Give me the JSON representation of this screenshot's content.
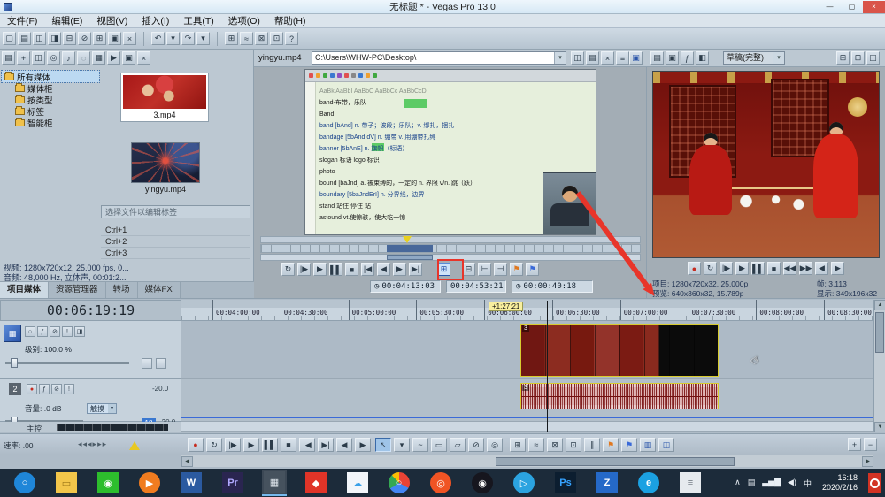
{
  "icons": {
    "caret": "▾",
    "clock": "◷",
    "up": "▲",
    "down": "▼",
    "left": "◀",
    "right": "▶",
    "hand": "☞"
  },
  "window": {
    "title": "无标题 * - Vegas Pro 13.0",
    "controls": [
      {
        "n": "minimize-button",
        "g": "—"
      },
      {
        "n": "maximize-button",
        "g": "▢"
      },
      {
        "n": "close-button",
        "g": "×"
      }
    ]
  },
  "menu": {
    "items": [
      "文件(F)",
      "编辑(E)",
      "视图(V)",
      "插入(I)",
      "工具(T)",
      "选项(O)",
      "帮助(H)"
    ]
  },
  "toolbar": {
    "group1": [
      {
        "n": "new-project",
        "g": "▢"
      },
      {
        "n": "open-project",
        "g": "▤"
      },
      {
        "n": "save-project",
        "g": "◫"
      },
      {
        "n": "render-as",
        "g": "◨"
      },
      {
        "n": "project-properties",
        "g": "⊟"
      },
      {
        "n": "cut",
        "g": "⊘"
      },
      {
        "n": "copy",
        "g": "⊞"
      },
      {
        "n": "paste",
        "g": "▣"
      },
      {
        "n": "delete",
        "g": "×"
      }
    ],
    "group2": [
      {
        "n": "undo",
        "g": "↶"
      },
      {
        "n": "undo-menu",
        "g": "▾"
      },
      {
        "n": "redo",
        "g": "↷"
      },
      {
        "n": "redo-menu",
        "g": "▾"
      }
    ],
    "group3": [
      {
        "n": "enable-snapping",
        "g": "⊞"
      },
      {
        "n": "auto-ripple",
        "g": "≈"
      },
      {
        "n": "lock-envelopes",
        "g": "⊠"
      },
      {
        "n": "ignore-event-grouping",
        "g": "⊡"
      },
      {
        "n": "whats-this-help",
        "g": "?"
      }
    ]
  },
  "media": {
    "toolbar": [
      {
        "n": "new-bin",
        "g": "▤"
      },
      {
        "n": "import-media",
        "g": "+"
      },
      {
        "n": "capture-video",
        "g": "◫"
      },
      {
        "n": "get-media-from-web",
        "g": "◎"
      },
      {
        "n": "extract-audio",
        "g": "♪"
      },
      {
        "n": "media-search",
        "g": "◌"
      },
      {
        "n": "views-menu",
        "g": "▦"
      },
      {
        "n": "auto-preview",
        "g": "▶"
      },
      {
        "n": "media-properties",
        "g": "▣"
      },
      {
        "n": "remove-selected-media",
        "g": "×"
      }
    ],
    "tree": [
      {
        "label": "所有媒体",
        "sel": true
      },
      {
        "label": "媒体柜",
        "child": true
      },
      {
        "label": "按类型",
        "child": true
      },
      {
        "label": "标签",
        "child": true
      },
      {
        "label": "智能柜",
        "child": true
      }
    ],
    "items": [
      {
        "name": "3.mp4"
      },
      {
        "name": "yingyu.mp4"
      }
    ],
    "tag_hint": "选择文件以编辑标签",
    "shortcuts": [
      "Ctrl+1",
      "Ctrl+2",
      "Ctrl+3"
    ],
    "video_info": "视频: 1280x720x12, 25.000 fps, 0...",
    "audio_info": "音频: 48,000 Hz, 立体声, 00:01:2...",
    "tabs": [
      {
        "label": "项目媒体",
        "active": true
      },
      {
        "label": "资源管理器"
      },
      {
        "label": "转场"
      },
      {
        "label": "媒体FX"
      }
    ]
  },
  "trimmer": {
    "filename": "yingyu.mp4",
    "path": "C:\\Users\\WHW-PC\\Desktop\\",
    "header_icons": [
      {
        "n": "trimmer-save-markers",
        "g": "◫"
      },
      {
        "n": "trimmer-media-properties",
        "g": "▤"
      },
      {
        "n": "trimmer-remove",
        "g": "×"
      },
      {
        "n": "trimmer-menu",
        "g": "≡"
      }
    ],
    "external_monitor_glyph": "▣",
    "doc_toolbar_dots": [
      "#e05050",
      "#f0a030",
      "#40a840",
      "#3a78d0",
      "#9050c0",
      "#e05050",
      "#888888",
      "#3a78d0",
      "#f0a030",
      "#40a840"
    ],
    "doc_lines": [
      {
        "t": "AaBk AaBbI AaBbC AaBbCc AaBbCcD",
        "c": "#8a9288"
      },
      {
        "t": "band-布带，乐队",
        "c": "#1a1a1a"
      },
      {
        "t": "Band",
        "c": "#1a1a1a"
      },
      {
        "t": "band   [bAnd]   n. 带子；波段；乐队；v. 绑扎，捆扎",
        "c": "#16408a"
      },
      {
        "t": "bandage [5bAndIdV]   n. 绷带  v. 用绷带扎缚",
        "c": "#16408a"
      },
      {
        "t": "banner  [5bAnE]   n. 旗帜（标语）",
        "c": "#16408a"
      },
      {
        "t": "slogan 标语   logo 标识",
        "c": "#1a1a1a"
      },
      {
        "t": "photo",
        "c": "#1a1a1a"
      },
      {
        "t": "bound  [baJnd] a. 被束缚的，一定的  n. 界限  v/n. 跳（跃）",
        "c": "#1a1a1a"
      },
      {
        "t": "boundary [5baJndErI]   n. 分界线，边界",
        "c": "#16408a"
      },
      {
        "t": "stand  站住 停住 站",
        "c": "#1a1a1a"
      },
      {
        "t": "astound  vt.使惊骇，使大吃一惊",
        "c": "#1a1a1a"
      }
    ],
    "transport": [
      {
        "n": "trimmer-loop",
        "g": "↻"
      },
      {
        "n": "trimmer-play-from-start",
        "g": "|▶"
      },
      {
        "n": "trimmer-play",
        "g": "▶"
      },
      {
        "n": "trimmer-pause",
        "g": "▌▌"
      },
      {
        "n": "trimmer-stop",
        "g": "■"
      },
      {
        "n": "trimmer-go-to-start",
        "g": "|◀"
      },
      {
        "n": "trimmer-prev-frame",
        "g": "◀"
      },
      {
        "n": "trimmer-next-frame",
        "g": "▶"
      },
      {
        "n": "trimmer-go-to-end",
        "g": "▶|"
      },
      {
        "n": "add-media-from-cursor",
        "g": "⊞",
        "hl": true
      },
      {
        "n": "add-media-up-to-cursor",
        "g": "⊟"
      },
      {
        "n": "mark-in",
        "g": "⊢"
      },
      {
        "n": "mark-out",
        "g": "⊣"
      },
      {
        "n": "drop-marker",
        "g": "⚑",
        "c": "#e07820"
      },
      {
        "n": "drop-region",
        "g": "⚑",
        "c": "#3a6ad8"
      }
    ],
    "time_in": "00:04:13:03",
    "time_out": "00:04:53:21",
    "duration": "00:00:40:18"
  },
  "preview": {
    "toolbar": [
      {
        "n": "project-video-properties",
        "g": "▤"
      },
      {
        "n": "preview-on-external-monitor",
        "g": "▣"
      },
      {
        "n": "video-output-fx",
        "g": "ƒ"
      },
      {
        "n": "split-screen-view",
        "g": "◧"
      }
    ],
    "quality": "草稿(完整)",
    "toolbar2": [
      {
        "n": "overlays-menu",
        "g": "⊞"
      },
      {
        "n": "copy-snapshot",
        "g": "⊡"
      },
      {
        "n": "save-snapshot",
        "g": "◫"
      }
    ],
    "transport": [
      {
        "n": "preview-record",
        "g": "●",
        "c": "#c62c20"
      },
      {
        "n": "preview-loop",
        "g": "↻"
      },
      {
        "n": "preview-play-from-start",
        "g": "|▶"
      },
      {
        "n": "preview-play",
        "g": "▶"
      },
      {
        "n": "preview-pause",
        "g": "▌▌"
      },
      {
        "n": "preview-stop",
        "g": "■"
      },
      {
        "n": "preview-go-to-start",
        "g": "◀◀"
      },
      {
        "n": "preview-go-to-end",
        "g": "▶▶"
      },
      {
        "n": "preview-prev-frame",
        "g": "◀"
      },
      {
        "n": "preview-next-frame",
        "g": "▶"
      }
    ],
    "project_info": "项目: 1280x720x32, 25.000p",
    "frame_info": "帧: 3,113",
    "preview_info": "预览: 640x360x32, 15.789p",
    "display_info": "显示: 349x196x32"
  },
  "timeline": {
    "current_time": "00:06:19:19",
    "ruler_ticks": [
      "00:04:00:00",
      "00:04:30:00",
      "00:05:00:00",
      "00:05:30:00",
      "00:06:00:00",
      "00:06:30:00",
      "00:07:00:00",
      "00:07:30:00",
      "00:08:00:00",
      "00:08:30:00"
    ],
    "offset_badge": "+1:27:21",
    "clip_label": "3",
    "track1": {
      "icon_glyph": "▦",
      "buttons": [
        {
          "n": "track1-bypass-motion-blur",
          "g": "○"
        },
        {
          "n": "track1-fx",
          "g": "ƒ"
        },
        {
          "n": "track1-mute",
          "g": "⊘"
        },
        {
          "n": "track1-solo",
          "g": "!"
        },
        {
          "n": "track1-compositing-mode",
          "g": "◨"
        }
      ],
      "level_label": "级别: 100.0 %"
    },
    "track2": {
      "number": "2",
      "buttons": [
        {
          "n": "track2-arm-for-record",
          "g": "●",
          "c": "#c62c20"
        },
        {
          "n": "track2-fx",
          "g": "ƒ"
        },
        {
          "n": "track2-mute",
          "g": "⊘"
        },
        {
          "n": "track2-solo",
          "g": "!"
        }
      ],
      "volume_label": "音量: .0 dB",
      "automation": "触摸",
      "value1": "-20.0",
      "pan_badge": "18",
      "value2": "-20.0"
    },
    "master_label": "主控",
    "rate_label": "速率: .00",
    "rate_chevrons": "◂◂◂▸▸▸",
    "transport": [
      {
        "n": "record",
        "g": "●",
        "c": "#c62c20"
      },
      {
        "n": "loop-playback",
        "g": "↻"
      },
      {
        "n": "play-from-start",
        "g": "|▶"
      },
      {
        "n": "play",
        "g": "▶"
      },
      {
        "n": "pause",
        "g": "▌▌"
      },
      {
        "n": "stop",
        "g": "■"
      },
      {
        "n": "go-to-start",
        "g": "|◀"
      },
      {
        "n": "go-to-end",
        "g": "▶|"
      },
      {
        "n": "prev-frame",
        "g": "◀"
      },
      {
        "n": "next-frame",
        "g": "▶"
      }
    ],
    "tools": [
      {
        "n": "normal-edit-tool",
        "g": "↖",
        "active": true
      },
      {
        "n": "edit-tool-menu",
        "g": "▾"
      },
      {
        "n": "envelope-edit-tool",
        "g": "~"
      },
      {
        "n": "selection-edit-tool",
        "g": "▭"
      },
      {
        "n": "paint-edit-tool",
        "g": "▱"
      },
      {
        "n": "erase-edit-tool",
        "g": "⊘"
      },
      {
        "n": "zoom-edit-tool",
        "g": "◎"
      }
    ],
    "helpers": [
      {
        "n": "enable-snapping",
        "g": "⊞"
      },
      {
        "n": "auto-ripple",
        "g": "≈"
      },
      {
        "n": "lock-envelopes",
        "g": "⊠"
      },
      {
        "n": "ignore-event-grouping",
        "g": "⊡"
      },
      {
        "n": "split-events",
        "g": "∥"
      },
      {
        "n": "insert-marker",
        "g": "⚑",
        "c": "#e07820"
      },
      {
        "n": "insert-region",
        "g": "⚑",
        "c": "#3a6ad8"
      },
      {
        "n": "mixer-window",
        "g": "▥",
        "c": "#2a55aa"
      },
      {
        "n": "open-in-trimmer",
        "g": "◫",
        "c": "#2a55aa"
      }
    ],
    "zoom": [
      {
        "n": "zoom-in-time",
        "g": "+"
      },
      {
        "n": "zoom-out-time",
        "g": "−"
      }
    ]
  },
  "taskbar": {
    "icons": [
      {
        "n": "taskbar-cortana",
        "g": "○",
        "bg": "#1f86d8",
        "fg": "#ffffff",
        "round": true
      },
      {
        "n": "taskbar-file-explorer",
        "g": "▭",
        "bg": "#f3c64a",
        "fg": "#9a7416"
      },
      {
        "n": "taskbar-wechat",
        "g": "◉",
        "bg": "#2dbe2d",
        "fg": "#ffffff"
      },
      {
        "n": "taskbar-potplayer",
        "g": "▶",
        "bg": "#f07c20",
        "fg": "#ffffff",
        "round": true
      },
      {
        "n": "taskbar-word",
        "g": "W",
        "bg": "#2b5aa0",
        "fg": "#ffffff"
      },
      {
        "n": "taskbar-premiere",
        "g": "Pr",
        "bg": "#2a2550",
        "fg": "#b0a8ff"
      },
      {
        "n": "taskbar-vegas-pro",
        "g": "▦",
        "bg": "#46525e",
        "fg": "#dde4ea",
        "active": true
      },
      {
        "n": "taskbar-red-app",
        "g": "◆",
        "bg": "#e03428",
        "fg": "#ffffff"
      },
      {
        "n": "taskbar-weiyun",
        "g": "☁",
        "bg": "#f2f6fa",
        "fg": "#38a0e8"
      },
      {
        "n": "taskbar-chrome",
        "g": "○",
        "bg": "conic-gradient(#ea4335 0 33%,#4285f4 33% 66%,#34a853 66% 88%,#fbbc05 88% 100%)",
        "fg": "#ffffff",
        "round": true
      },
      {
        "n": "taskbar-browser-orange",
        "g": "◎",
        "bg": "#f05424",
        "fg": "#ffffff",
        "round": true
      },
      {
        "n": "taskbar-qq",
        "g": "◉",
        "bg": "#16161e",
        "fg": "#ffffff",
        "round": true
      },
      {
        "n": "taskbar-telegram",
        "g": "▷",
        "bg": "#2ba3e0",
        "fg": "#ffffff",
        "round": true
      },
      {
        "n": "taskbar-photoshop",
        "g": "Ps",
        "bg": "#0c1e30",
        "fg": "#36a3ff"
      },
      {
        "n": "taskbar-blue-note-app",
        "g": "Z",
        "bg": "#2569c8",
        "fg": "#ffffff"
      },
      {
        "n": "taskbar-edge",
        "g": "e",
        "bg": "#1ba1e2",
        "fg": "#ffffff",
        "round": true
      },
      {
        "n": "taskbar-notes",
        "g": "≡",
        "bg": "#e6eaee",
        "fg": "#7a828a"
      }
    ],
    "tray": [
      {
        "n": "tray-hidden-icons",
        "g": "∧"
      },
      {
        "n": "tray-app-icon",
        "g": "▤"
      },
      {
        "n": "tray-network",
        "g": "▃▅▇"
      },
      {
        "n": "tray-volume",
        "g": "◀)"
      },
      {
        "n": "tray-ime",
        "g": "中"
      }
    ],
    "time": "16:18",
    "date": "2020/2/16"
  }
}
